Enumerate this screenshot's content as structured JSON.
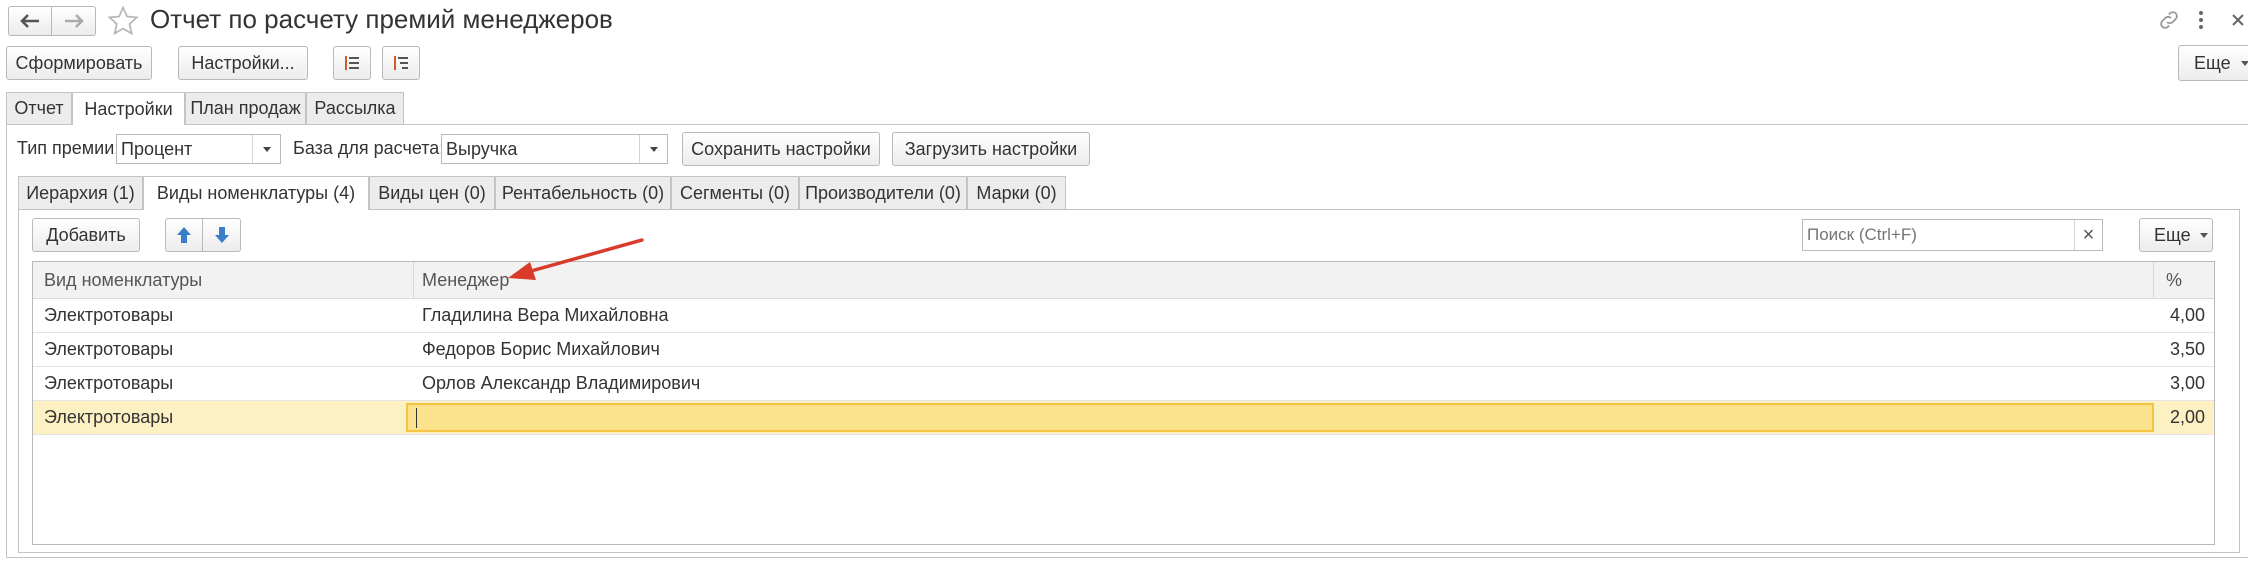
{
  "window": {
    "title": "Отчет по расчету премий менеджеров",
    "more_label": "Еще"
  },
  "toolbar": {
    "generate_label": "Сформировать",
    "settings_label": "Настройки..."
  },
  "main_tabs": [
    {
      "label": "Отчет"
    },
    {
      "label": "Настройки"
    },
    {
      "label": "План продаж"
    },
    {
      "label": "Рассылка"
    }
  ],
  "settings": {
    "bonus_type_label": "Тип премии:",
    "bonus_type_value": "Процент",
    "base_label": "База для расчета:",
    "base_value": "Выручка",
    "save_label": "Сохранить настройки",
    "load_label": "Загрузить настройки"
  },
  "sub_tabs": [
    {
      "label": "Иерархия (1)"
    },
    {
      "label": "Виды номенклатуры (4)"
    },
    {
      "label": "Виды цен (0)"
    },
    {
      "label": "Рентабельность (0)"
    },
    {
      "label": "Сегменты (0)"
    },
    {
      "label": "Производители (0)"
    },
    {
      "label": "Марки (0)"
    }
  ],
  "table_toolbar": {
    "add_label": "Добавить",
    "search_placeholder": "Поиск (Ctrl+F)",
    "clear_label": "×",
    "more_label": "Еще"
  },
  "table": {
    "columns": [
      "Вид номенклатуры",
      "Менеджер",
      "%"
    ],
    "rows": [
      {
        "kind": "Электротовары",
        "manager": "Гладилина Вера Михайловна",
        "percent": "4,00"
      },
      {
        "kind": "Электротовары",
        "manager": "Федоров Борис Михайлович",
        "percent": "3,50"
      },
      {
        "kind": "Электротовары",
        "manager": "Орлов Александр Владимирович",
        "percent": "3,00"
      },
      {
        "kind": "Электротовары",
        "manager": "",
        "percent": "2,00"
      }
    ]
  },
  "colors": {
    "accent_selected_row": "#fdf0c3",
    "accent_active_cell": "#fbe38e",
    "active_cell_border": "#f5c443",
    "arrow": "#d93b2b",
    "arrow_buttons": "#3a7ec8"
  },
  "icons": [
    "back-icon",
    "forward-icon",
    "star-icon",
    "link-icon",
    "kebab-icon",
    "close-icon",
    "list-settings-icon",
    "list-sort-icon",
    "arrow-up-icon",
    "arrow-down-icon"
  ]
}
